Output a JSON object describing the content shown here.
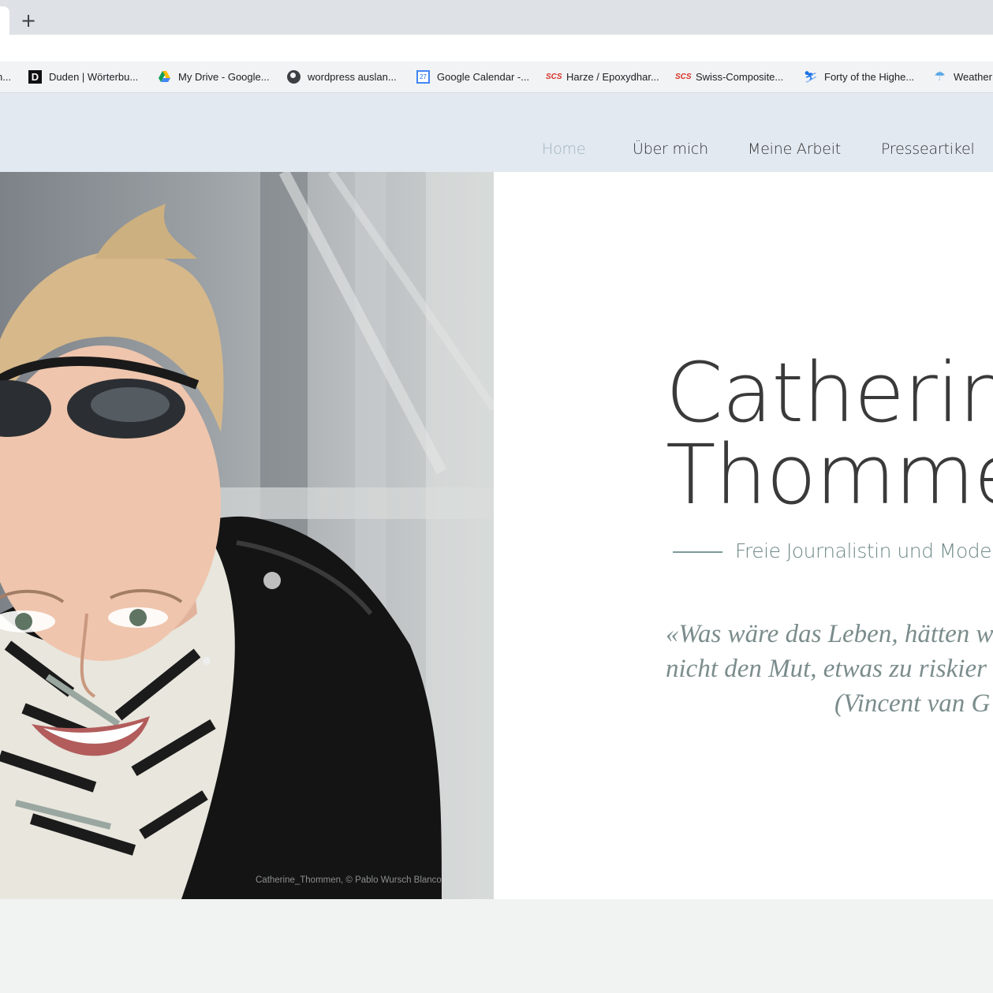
{
  "browser": {
    "new_tab_symbol": "+",
    "bookmarks": [
      {
        "label": "n...",
        "icon": "none"
      },
      {
        "label": "Duden | Wörterbu...",
        "icon": "duden-icon",
        "glyph": "D"
      },
      {
        "label": "My Drive - Google...",
        "icon": "google-drive-icon"
      },
      {
        "label": "wordpress auslan...",
        "icon": "globe-icon"
      },
      {
        "label": "Google Calendar -...",
        "icon": "google-calendar-icon",
        "glyph": "27"
      },
      {
        "label": "Harze / Epoxydhar...",
        "icon": "scs-icon",
        "glyph": "SCS"
      },
      {
        "label": "Swiss-Composite...",
        "icon": "scs-icon",
        "glyph": "SCS"
      },
      {
        "label": "Forty of the Highe...",
        "icon": "skier-icon"
      },
      {
        "label": "Weather",
        "icon": "umbrella-icon"
      }
    ]
  },
  "site": {
    "nav": [
      {
        "label": "Home",
        "active": true
      },
      {
        "label": "Über mich",
        "active": false
      },
      {
        "label": "Meine Arbeit",
        "active": false
      },
      {
        "label": "Presseartikel",
        "active": false
      }
    ],
    "hero": {
      "name_line1": "Catherine",
      "name_line2": "Thommen",
      "subtitle": "Freie Journalistin und Moderato",
      "quote_line1": "«Was wäre das Leben, hätten w",
      "quote_line2": "nicht den Mut, etwas zu riskier",
      "quote_line3": "(Vincent van G",
      "photo_credit": "Catherine_Thommen, © Pablo Wursch Blanco"
    },
    "colors": {
      "header_bg": "#e3e9f1",
      "nav_active": "#9fb4bf",
      "accent": "#6f8988"
    }
  }
}
